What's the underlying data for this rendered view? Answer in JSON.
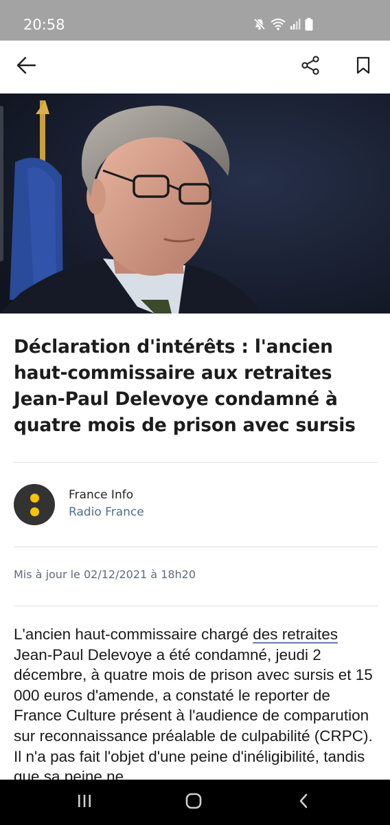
{
  "status_bar": {
    "time": "20:58",
    "icons": [
      "mute-icon",
      "wifi-icon",
      "signal-icon",
      "battery-icon"
    ]
  },
  "app_bar": {
    "icons": [
      "back-arrow-icon",
      "share-icon",
      "bookmark-icon"
    ]
  },
  "article": {
    "title": "Déclaration d'intérêts : l'ancien haut-commissaire aux retraites Jean-Paul Delevoye condamné à quatre mois de prison avec sursis",
    "source": {
      "name": "France Info",
      "publisher": "Radio France",
      "logo_color": "#333333",
      "logo_accent": "#f8c400"
    },
    "updated": "Mis à jour le 02/12/2021 à 18h20",
    "body": {
      "before_link": "L'ancien haut-commissaire chargé ",
      "link_text": "des retraites",
      "after_link": " Jean-Paul Delevoye a été condamné, jeudi 2 décembre, à quatre mois de prison avec sursis et 15 000 euros d'amende, a constaté le reporter de France Culture présent à l'audience de comparution sur reconnaissance préalable de culpabilité (CRPC). Il n'a pas fait l'objet d'une peine d'inéligibilité, tandis que sa peine ne"
    }
  },
  "nav_bar": {
    "icons": [
      "recents-icon",
      "home-icon",
      "back-icon"
    ]
  },
  "colors": {
    "status_bar": "#a3a3a3",
    "link_underline": "#5f7fa5",
    "publisher_text": "#4d6e8c",
    "nav_bar": "#000000"
  }
}
